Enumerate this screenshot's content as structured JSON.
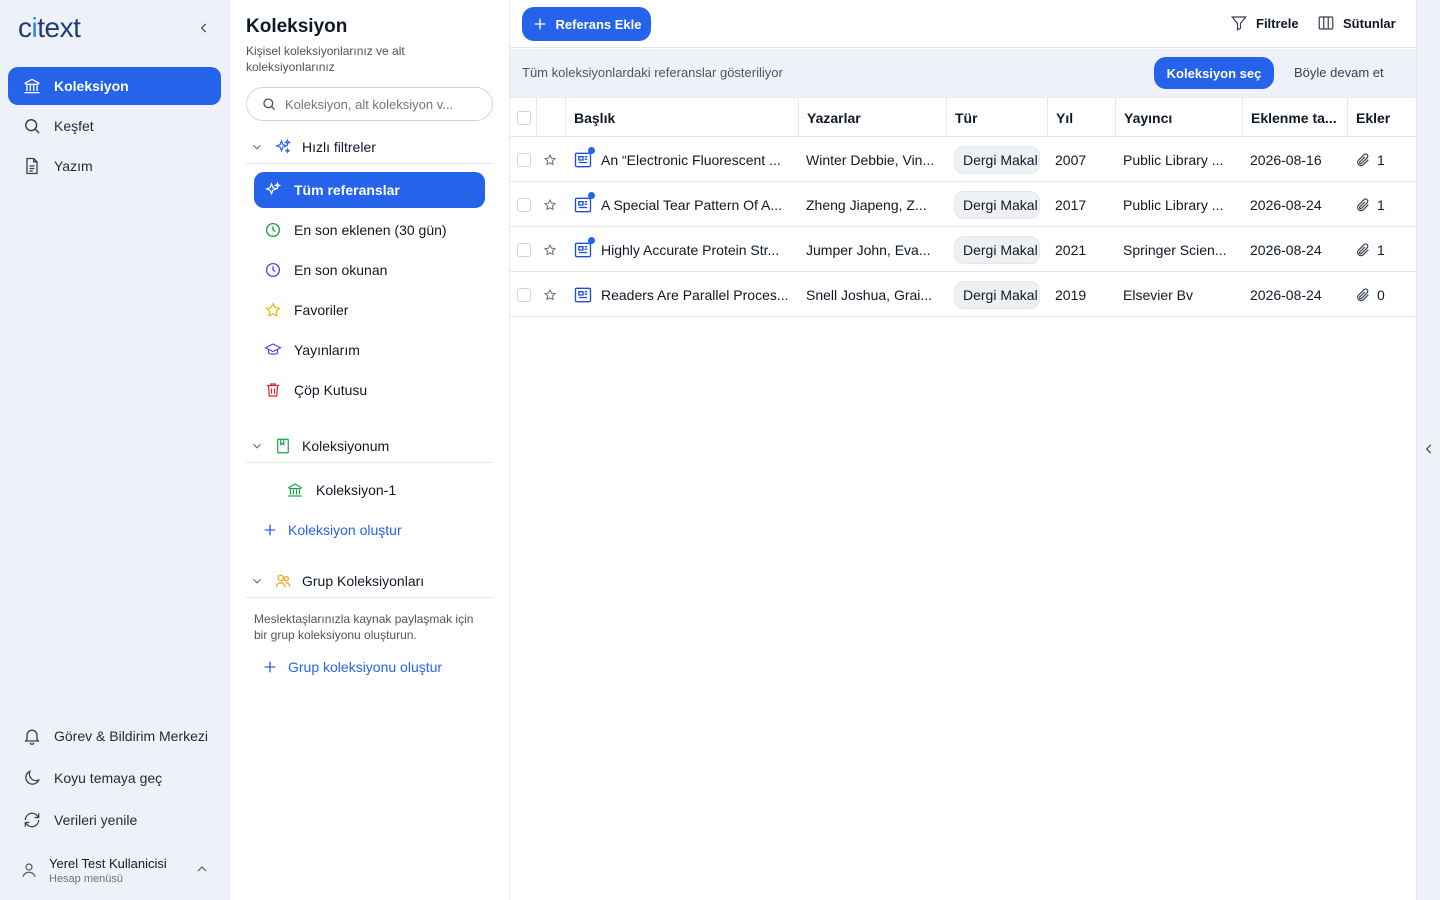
{
  "app": {
    "logo": "citext",
    "logo_prefix": "c",
    "logo_accent": "i",
    "logo_suffix": "text"
  },
  "nav": {
    "items": [
      {
        "label": "Koleksiyon",
        "icon": "bank-icon",
        "active": true
      },
      {
        "label": "Keşfet",
        "icon": "search-icon",
        "active": false
      },
      {
        "label": "Yazım",
        "icon": "document-icon",
        "active": false
      }
    ],
    "bottom": [
      {
        "label": "Görev & Bildirim Merkezi",
        "icon": "bell-icon"
      },
      {
        "label": "Koyu temaya geç",
        "icon": "moon-icon"
      },
      {
        "label": "Verileri yenile",
        "icon": "refresh-icon"
      }
    ],
    "account": {
      "name": "Yerel Test Kullanicisi",
      "menu": "Hesap menüsü"
    }
  },
  "collections": {
    "title": "Koleksiyon",
    "subtitle": "Kişisel koleksiyonlarınız ve alt koleksiyonlarınız",
    "search_placeholder": "Koleksiyon, alt koleksiyon v...",
    "quick_filters": {
      "title": "Hızlı filtreler",
      "items": [
        {
          "label": "Tüm referanslar",
          "active": true
        },
        {
          "label": "En son eklenen (30 gün)"
        },
        {
          "label": "En son okunan"
        },
        {
          "label": "Favoriler"
        },
        {
          "label": "Yayınlarım"
        },
        {
          "label": "Çöp Kutusu"
        }
      ]
    },
    "my_collections": {
      "title": "Koleksiyonum",
      "items": [
        {
          "label": "Koleksiyon-1"
        }
      ],
      "create_label": "Koleksiyon oluştur"
    },
    "group_collections": {
      "title": "Grup Koleksiyonları",
      "note": "Meslektaşlarınızla kaynak paylaşmak için bir grup koleksiyonu oluşturun.",
      "create_label": "Grup koleksiyonu oluştur"
    }
  },
  "toolbar": {
    "add_label": "Referans Ekle",
    "filter_label": "Filtrele",
    "columns_label": "Sütunlar"
  },
  "infobar": {
    "message": "Tüm koleksiyonlardaki referanslar gösteriliyor",
    "pick_label": "Koleksiyon seç",
    "continue_label": "Böyle devam et"
  },
  "table": {
    "columns": [
      "Başlık",
      "Yazarlar",
      "Tür",
      "Yıl",
      "Yayıncı",
      "Eklenme ta...",
      "Ekler"
    ],
    "rows": [
      {
        "title": "An “Electronic Fluorescent ...",
        "authors": "Winter Debbie, Vin...",
        "type": "Dergi Makal",
        "year": "2007",
        "publisher": "Public Library ...",
        "added": "2026-08-16",
        "attachments": "1",
        "unread": true
      },
      {
        "title": "A Special Tear Pattern Of A...",
        "authors": "Zheng Jiapeng, Z...",
        "type": "Dergi Makal",
        "year": "2017",
        "publisher": "Public Library ...",
        "added": "2026-08-24",
        "attachments": "1",
        "unread": true
      },
      {
        "title": "Highly Accurate Protein Str...",
        "authors": "Jumper John, Eva...",
        "type": "Dergi Makal",
        "year": "2021",
        "publisher": "Springer Scien...",
        "added": "2026-08-24",
        "attachments": "1",
        "unread": true
      },
      {
        "title": "Readers Are Parallel Proces...",
        "authors": "Snell Joshua, Grai...",
        "type": "Dergi Makal",
        "year": "2019",
        "publisher": "Elsevier Bv",
        "added": "2026-08-24",
        "attachments": "0",
        "unread": false
      }
    ]
  },
  "colors": {
    "accent": "#2563eb",
    "sidebar_bg": "#eef2f8",
    "logo": "#1f3d7a"
  }
}
